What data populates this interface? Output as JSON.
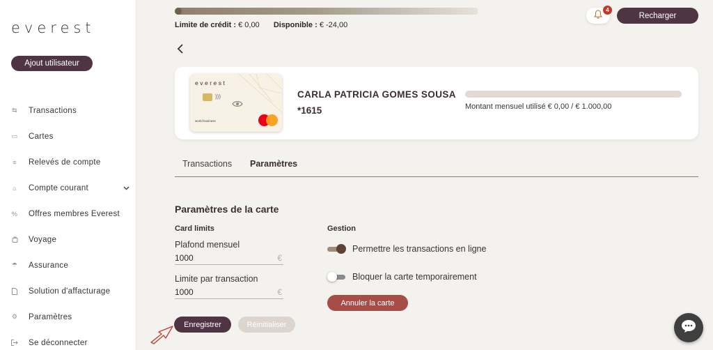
{
  "sidebar": {
    "logo": "everest",
    "add_user_label": "Ajout utilisateur",
    "items": [
      {
        "label": "Transactions",
        "icon": "transfer-arrows-icon"
      },
      {
        "label": "Cartes",
        "icon": "card-icon"
      },
      {
        "label": "Relevés de compte",
        "icon": "statement-lines-icon"
      },
      {
        "label": "Compte courant",
        "icon": "bank-icon",
        "has_chevron": true
      },
      {
        "label": "Offres membres Everest",
        "icon": "percent-icon"
      },
      {
        "label": "Voyage",
        "icon": "suitcase-icon"
      },
      {
        "label": "Assurance",
        "icon": "umbrella-icon"
      },
      {
        "label": "Solution d'affacturage",
        "icon": "document-icon"
      },
      {
        "label": "Paramètres",
        "icon": "gear-icon"
      },
      {
        "label": "Se déconnecter",
        "icon": "logout-icon"
      }
    ]
  },
  "topbar": {
    "credit_limit_label": "Limite de crédit :",
    "credit_limit_value": "€ 0,00",
    "available_label": "Disponible :",
    "available_value": "€ -24,00",
    "notification_count": "4",
    "recharge_label": "Recharger"
  },
  "card": {
    "card_brand_text": "everest",
    "card_small_text": "world business",
    "holder_name": "CARLA PATRICIA GOMES SOUSA",
    "number": "*1615",
    "monthly_usage_text": "Montant mensuel utilisé € 0,00 / € 1.000,00",
    "monthly_used_fraction": 0
  },
  "tabs": [
    {
      "label": "Transactions",
      "active": false
    },
    {
      "label": "Paramètres",
      "active": true
    }
  ],
  "settings": {
    "title": "Paramètres de la carte",
    "limits_heading": "Card limits",
    "management_heading": "Gestion",
    "monthly_cap_label": "Plafond mensuel",
    "monthly_cap_value": "1000",
    "per_transaction_label": "Limite par transaction",
    "per_transaction_value": "1000",
    "currency_symbol": "€",
    "online_toggle_label": "Permettre les transactions en ligne",
    "online_toggle_on": true,
    "block_toggle_label": "Bloquer la carte temporairement",
    "block_toggle_on": false,
    "cancel_card_label": "Annuler la carte",
    "save_label": "Enregistrer",
    "reset_label": "Réinitialiser"
  },
  "colors": {
    "primary": "#4f3544",
    "danger": "#a54d46",
    "badge": "#c0392b"
  }
}
